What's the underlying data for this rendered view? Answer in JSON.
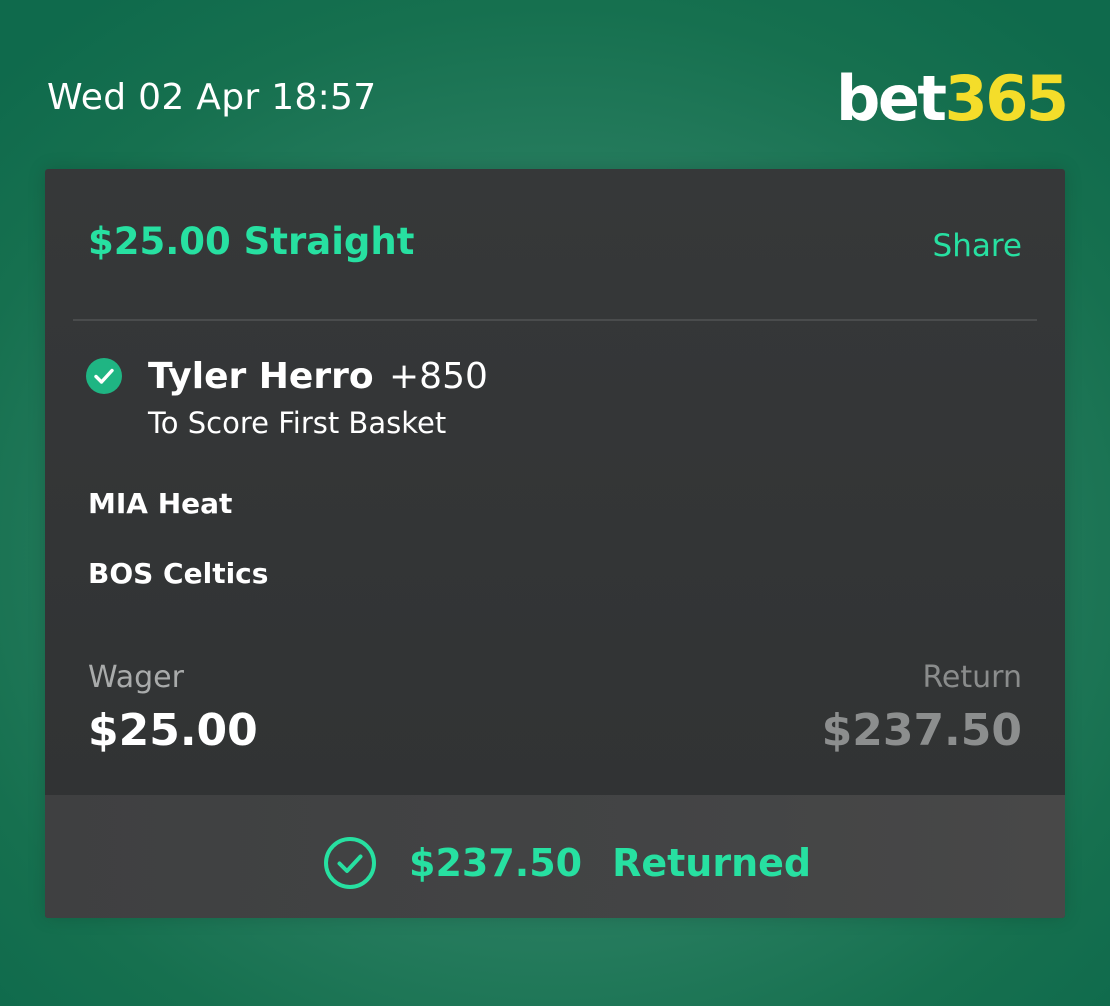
{
  "header": {
    "datetime": "Wed 02 Apr 18:57",
    "logo_part1": "bet",
    "logo_part2": "365"
  },
  "bet": {
    "title": "$25.00 Straight",
    "share_label": "Share",
    "selection": {
      "name": "Tyler Herro",
      "odds": "+850",
      "market": "To Score First Basket"
    },
    "teams": [
      "MIA Heat",
      "BOS Celtics"
    ],
    "wager_label": "Wager",
    "wager_value": "$25.00",
    "return_label": "Return",
    "return_value": "$237.50"
  },
  "footer": {
    "returned_amount": "$237.50",
    "returned_label": "Returned"
  },
  "colors": {
    "accent": "#27e0a1",
    "background": "#16704f",
    "card": "#333536",
    "logo_yellow": "#f4dd2a"
  },
  "icons": {
    "selection_status": "check-circle-filled-icon",
    "returned_status": "check-circle-outline-icon"
  }
}
